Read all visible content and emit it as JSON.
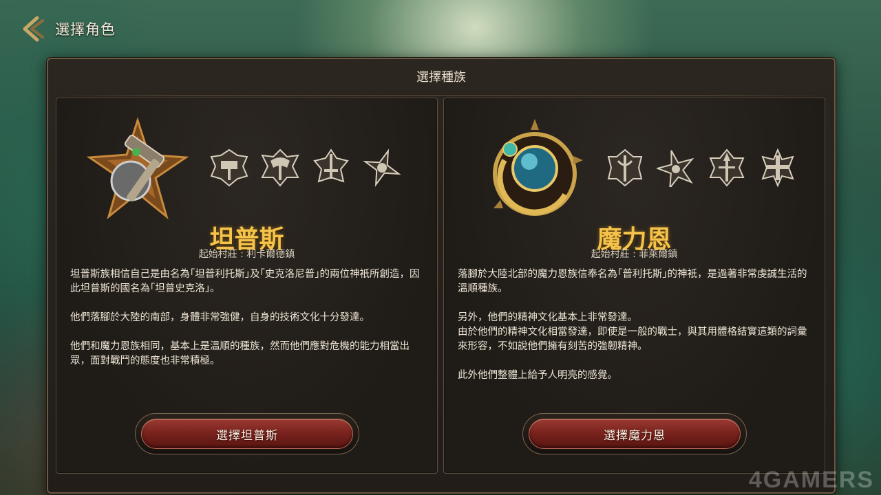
{
  "header": {
    "title": "選擇角色"
  },
  "panel": {
    "title": "選擇種族"
  },
  "races": [
    {
      "name": "坦普斯",
      "village": "起始村莊 : 利卡爾德鎮",
      "paragraphs": [
        "坦普斯族相信自己是由名為｢坦普利托斯｣及｢史克洛尼普｣的兩位神衹所創造，因此坦普斯的國名為｢坦普史克洛｣。",
        "他們落腳於大陸的南部，身體非常強健，自身的技術文化十分發達。",
        "他們和魔力恩族相同，基本上是溫順的種族，然而他們應對危機的能力相當出眾，面對戰鬥的態度也非常積極。"
      ],
      "button": "選擇坦普斯",
      "emblem": "axe-star-emblem-icon",
      "class_icons": [
        "class-hammer-icon",
        "class-axe-icon",
        "class-sword-icon",
        "class-shuriken-icon"
      ]
    },
    {
      "name": "魔力恩",
      "village": "起始村莊 : 菲萊爾鎮",
      "paragraphs": [
        "落腳於大陸北部的魔力恩族信奉名為｢普利托斯｣的神衹，是過著非常虔誠生活的溫順種族。",
        "另外，他們的精神文化基本上非常發達。\n由於他們的精神文化相當發達，即使是一般的戰士，與其用體格結實這類的詞彙來形容，不如說他們擁有刻苦的強韌精神。",
        "此外他們整體上給予人明亮的感覺。"
      ],
      "button": "選擇魔力恩",
      "emblem": "orb-crescent-emblem-icon",
      "class_icons": [
        "class-staff-icon",
        "class-star-icon",
        "class-spear-icon",
        "class-cross-icon"
      ]
    }
  ],
  "colors": {
    "race_name": "#f6c34a",
    "button_red": "#7a231e",
    "panel_border": "#6b5a44"
  },
  "watermark": "4GAMERS"
}
